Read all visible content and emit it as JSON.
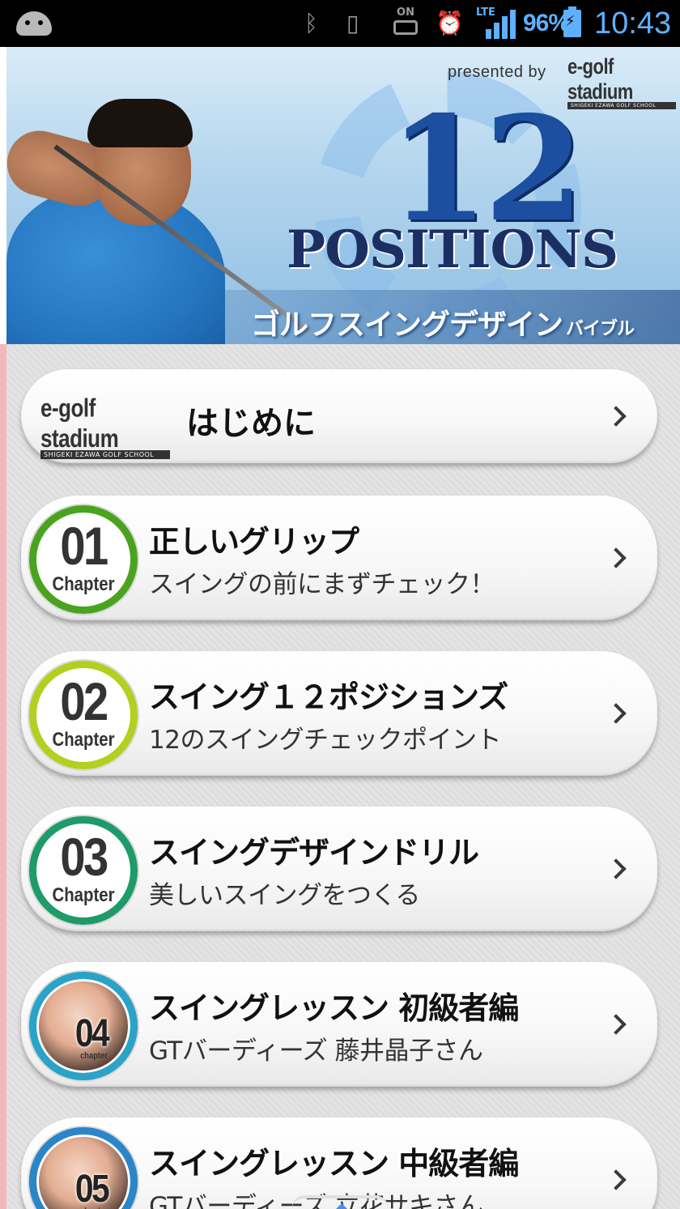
{
  "status_bar": {
    "on_label": "ON",
    "lte_label": "LTE",
    "battery_percent": "96%",
    "time": "10:43"
  },
  "banner": {
    "presented_by": "presented by",
    "logo_text": "e-golf stadium",
    "logo_sub": "SHIGEKI EZAWA GOLF SCHOOL",
    "number": "12",
    "positions": "POSITIONS",
    "subtitle": "ゴルフスイングデザイン",
    "subtitle_small": "バイブル"
  },
  "intro": {
    "logo_text": "e-golf stadium",
    "logo_sub": "SHIGEKI EZAWA GOLF SCHOOL",
    "title": "はじめに"
  },
  "chapters": [
    {
      "num": "01",
      "label": "Chapter",
      "title": "正しいグリップ",
      "subtitle": "スイングの前にまずチェック！"
    },
    {
      "num": "02",
      "label": "Chapter",
      "title": "スイング１２ポジションズ",
      "subtitle": "12のスイングチェックポイント"
    },
    {
      "num": "03",
      "label": "Chapter",
      "title": "スイングデザインドリル",
      "subtitle": "美しいスイングをつくる"
    },
    {
      "num": "04",
      "label": "chapter",
      "title": "スイングレッスン 初級者編",
      "subtitle": "GTバーディーズ  藤井晶子さん"
    },
    {
      "num": "05",
      "label": "chapter",
      "title": "スイングレッスン 中級者編",
      "subtitle": "GTバーディーズ  立花サキさん"
    }
  ],
  "colors": {
    "chapter1_ring": "#4aa31f",
    "chapter2_ring": "#b3cf1f",
    "chapter3_ring": "#1f9a6a",
    "chapter4_ring": "#2aa3c9",
    "chapter5_ring": "#2a86c9",
    "status_accent": "#5fb0ff"
  }
}
